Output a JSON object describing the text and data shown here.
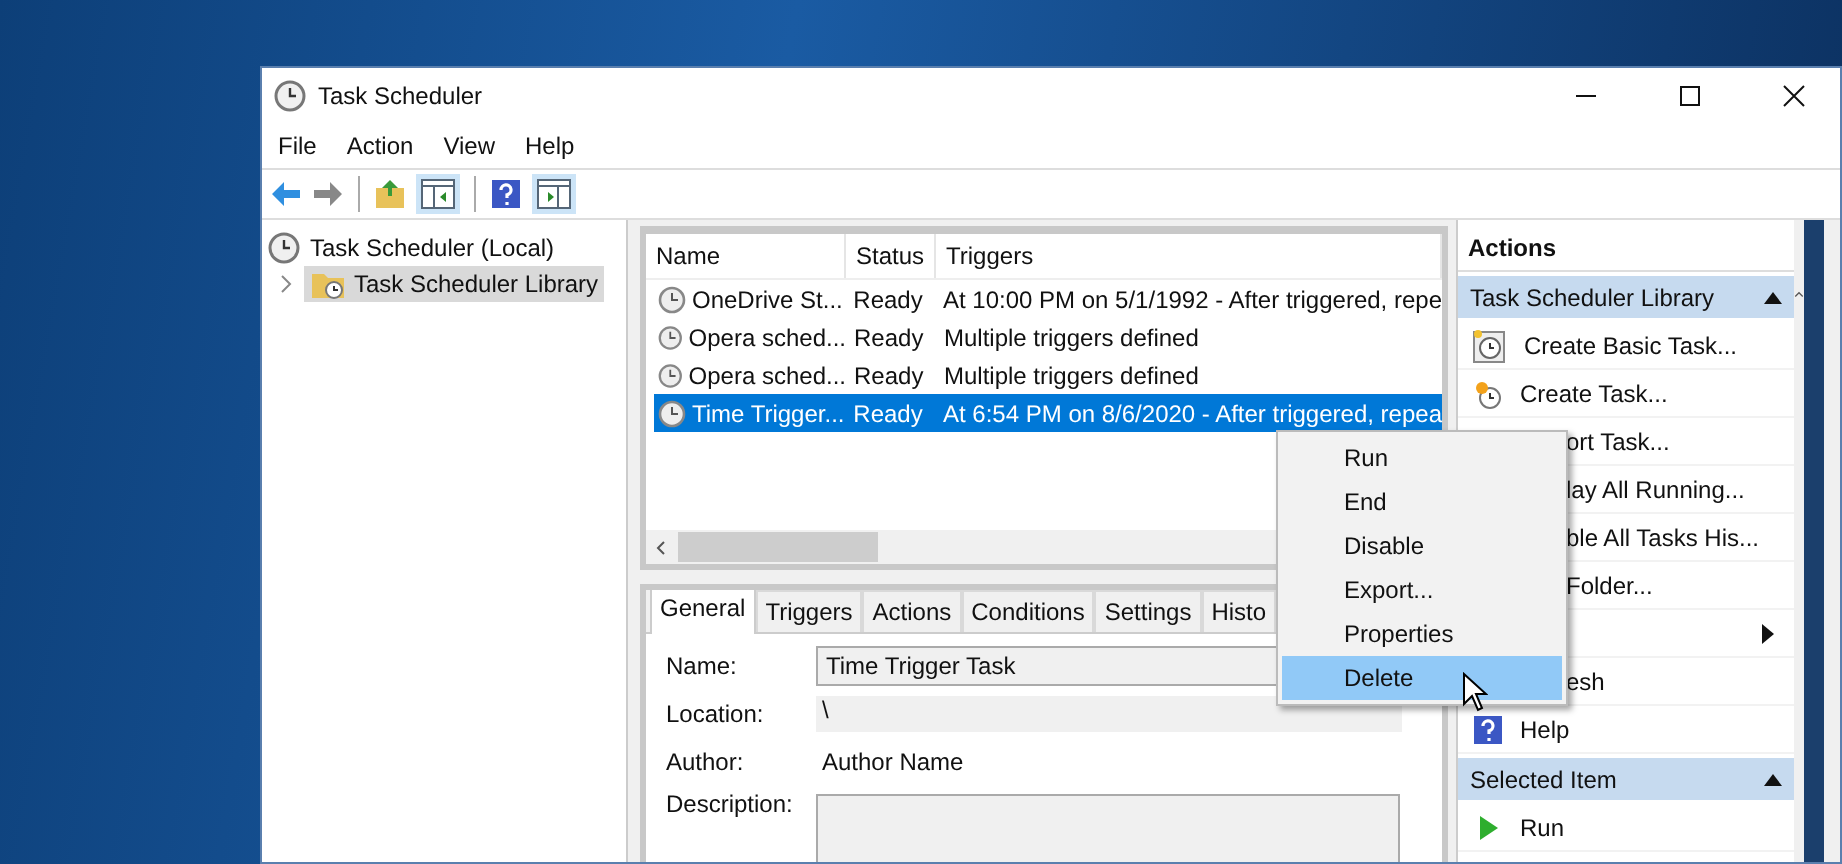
{
  "window": {
    "title": "Task Scheduler"
  },
  "menu": [
    "File",
    "Action",
    "View",
    "Help"
  ],
  "tree": {
    "label": "Task Scheduler (Local)",
    "children": [
      {
        "label": "Task Scheduler Library",
        "selected": true,
        "expanded": false
      }
    ]
  },
  "task_list": {
    "columns": [
      "Name",
      "Status",
      "Triggers"
    ],
    "rows": [
      {
        "name": "OneDrive St...",
        "status": "Ready",
        "triggers": "At 10:00 PM on 5/1/1992 - After triggered, repe",
        "selected": false
      },
      {
        "name": "Opera sched...",
        "status": "Ready",
        "triggers": "Multiple triggers defined",
        "selected": false
      },
      {
        "name": "Opera sched...",
        "status": "Ready",
        "triggers": "Multiple triggers defined",
        "selected": false
      },
      {
        "name": "Time Trigger...",
        "status": "Ready",
        "triggers": "At 6:54 PM on 8/6/2020 - After triggered, repea",
        "selected": true
      }
    ]
  },
  "details": {
    "tabs": [
      {
        "label": "General",
        "selected": true
      },
      {
        "label": "Triggers",
        "selected": false
      },
      {
        "label": "Actions",
        "selected": false
      },
      {
        "label": "Conditions",
        "selected": false
      },
      {
        "label": "Settings",
        "selected": false
      },
      {
        "label": "Histo",
        "selected": false
      }
    ],
    "name_label": "Name:",
    "name_value": "Time Trigger Task",
    "location_label": "Location:",
    "location_value": "\\",
    "author_label": "Author:",
    "author_value": "Author Name",
    "description_label": "Description:"
  },
  "context_menu": {
    "items": [
      {
        "label": "Run",
        "selected": false
      },
      {
        "label": "End",
        "selected": false
      },
      {
        "label": "Disable",
        "selected": false
      },
      {
        "label": "Export...",
        "selected": false
      },
      {
        "label": "Properties",
        "selected": false
      },
      {
        "label": "Delete",
        "selected": true
      }
    ]
  },
  "actions": {
    "title": "Actions",
    "groups": [
      {
        "title": "Task Scheduler Library",
        "expanded": true,
        "items": [
          {
            "kind": "basic_task",
            "label": "Create Basic Task..."
          },
          {
            "kind": "task",
            "label": "Create Task..."
          },
          {
            "kind": "clipped",
            "label": "ort Task..."
          },
          {
            "kind": "clipped",
            "label": "lay All Running..."
          },
          {
            "kind": "clipped",
            "label": "ble All Tasks His..."
          },
          {
            "kind": "clipped",
            "label": "Folder..."
          },
          {
            "kind": "submenu"
          },
          {
            "kind": "clipped",
            "label": "esh"
          },
          {
            "kind": "help",
            "label": "Help"
          }
        ]
      },
      {
        "title": "Selected Item",
        "expanded": true,
        "items": [
          {
            "kind": "run",
            "label": "Run"
          }
        ]
      }
    ]
  }
}
